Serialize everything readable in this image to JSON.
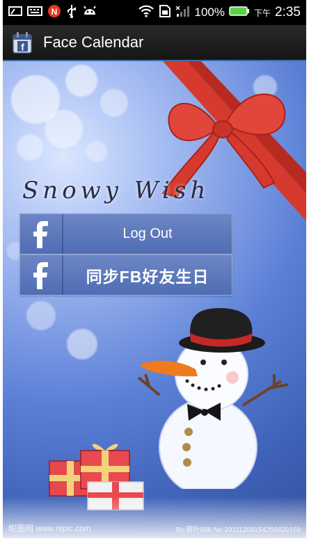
{
  "status_bar": {
    "battery_percent": "100%",
    "ampm": "下午",
    "time": "2:35"
  },
  "app": {
    "title": "Face Calendar"
  },
  "content": {
    "headline": "Snowy Wish",
    "buttons": [
      {
        "label": "Log Out"
      },
      {
        "label": "同步FB好友生日"
      }
    ],
    "watermark_left": "昵图网 www.nipic.com",
    "watermark_right": "By:荷叶888 No.20111208154258429169"
  },
  "colors": {
    "button_blue": "#5b77bb",
    "title_bar": "#1d1d1d",
    "status_bar": "#000000"
  }
}
